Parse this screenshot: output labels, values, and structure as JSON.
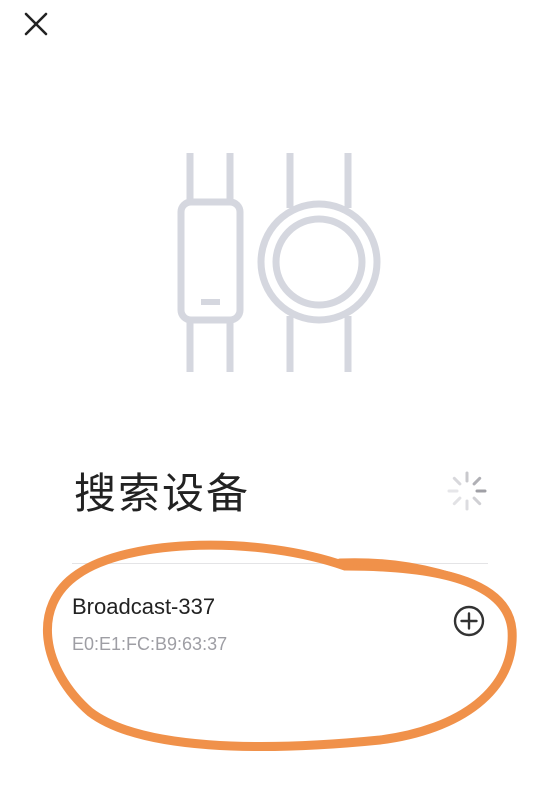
{
  "header": {
    "close_icon": "close-icon"
  },
  "illustration": {
    "icon": "band-and-watch-illustration",
    "color": "#d5d7df"
  },
  "search_section": {
    "title": "搜索设备",
    "loading_icon": "loading-spinner-icon"
  },
  "devices": [
    {
      "name": "Broadcast-337",
      "mac": "E0:E1:FC:B9:63:37",
      "action_icon": "add-circle-icon"
    }
  ],
  "annotation": {
    "color": "#f0914a"
  }
}
